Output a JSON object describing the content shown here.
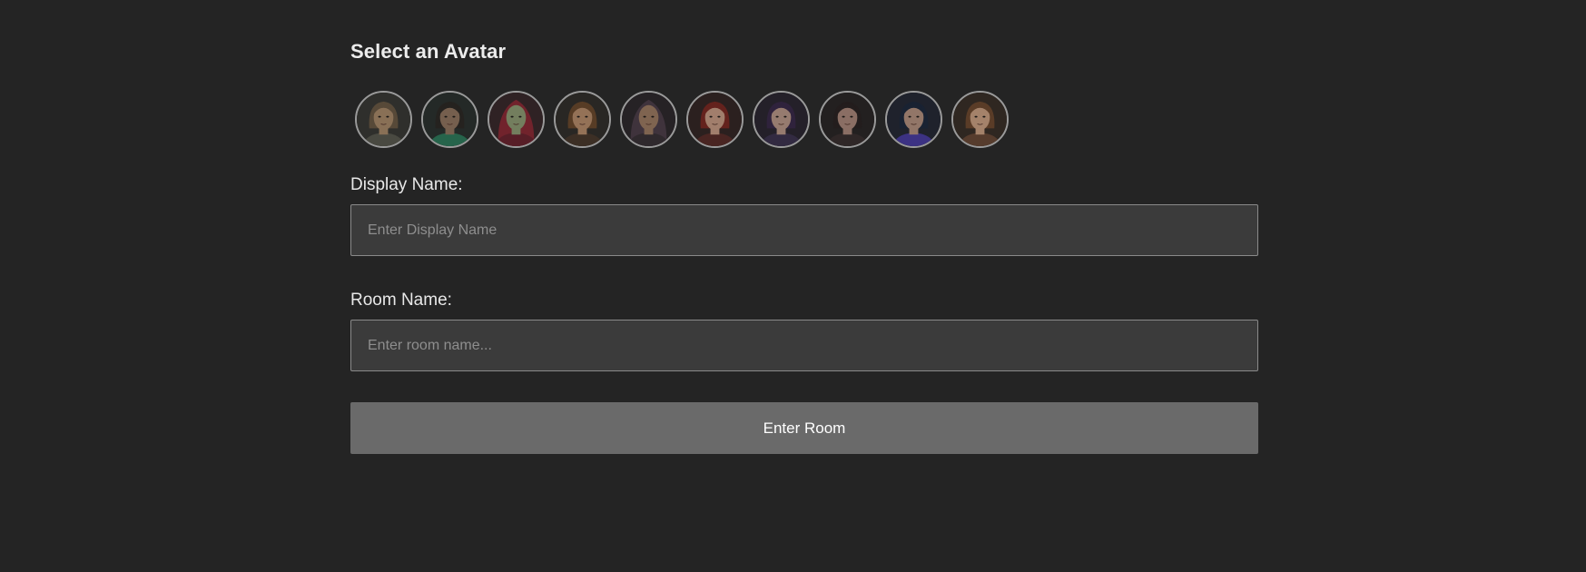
{
  "heading": "Select an Avatar",
  "avatars": [
    {
      "icon": "avatar-bald-man-icon",
      "skin": "#a8896a",
      "hair": "#6b5a45",
      "hood": null,
      "cloth": "#5a5a50",
      "bg": "#3a3a36"
    },
    {
      "icon": "avatar-bearded-man-icon",
      "skin": "#8f7560",
      "hair": "#2e2a26",
      "hood": null,
      "cloth": "#2f7a5c",
      "bg": "#2c3330"
    },
    {
      "icon": "avatar-red-hood-orc-icon",
      "skin": "#8d9a73",
      "hair": "#3a2a22",
      "hood": "#8a2b36",
      "cloth": "#6b2530",
      "bg": "#3a2a2c"
    },
    {
      "icon": "avatar-young-man-icon",
      "skin": "#b58b6b",
      "hair": "#6b4a2e",
      "hood": null,
      "cloth": "#4a3a2e",
      "bg": "#33302c"
    },
    {
      "icon": "avatar-hooded-warrior-icon",
      "skin": "#9c7a62",
      "hair": "#4a3c36",
      "hood": "#4e3f4a",
      "cloth": "#3a3238",
      "bg": "#2f2a2e"
    },
    {
      "icon": "avatar-red-hair-woman-icon",
      "skin": "#c59a84",
      "hair": "#7a2a24",
      "hood": null,
      "cloth": "#5a2e2a",
      "bg": "#352826"
    },
    {
      "icon": "avatar-purple-hair-woman-icon",
      "skin": "#b89688",
      "hair": "#3a2a4a",
      "hood": null,
      "cloth": "#3e3450",
      "bg": "#2c2833"
    },
    {
      "icon": "avatar-dark-hair-woman-icon",
      "skin": "#a9877a",
      "hair": "#2b2424",
      "hood": null,
      "cloth": "#3a3030",
      "bg": "#2b2828"
    },
    {
      "icon": "avatar-blue-hair-woman-icon",
      "skin": "#b3917f",
      "hair": "#1f2a3e",
      "hood": null,
      "cloth": "#4a3ea0",
      "bg": "#262a36"
    },
    {
      "icon": "avatar-brunette-woman-icon",
      "skin": "#c99f82",
      "hair": "#6e4a30",
      "hood": null,
      "cloth": "#6a4a38",
      "bg": "#3a3029"
    }
  ],
  "display_name": {
    "label": "Display Name:",
    "placeholder": "Enter Display Name",
    "value": ""
  },
  "room_name": {
    "label": "Room Name:",
    "placeholder": "Enter room name...",
    "value": ""
  },
  "enter_button": "Enter Room",
  "colors": {
    "background": "#242424",
    "input_background": "#3b3b3b",
    "input_border": "#8a8a8a",
    "button_background": "#6a6a6a",
    "avatar_ring": "#9a9a9a"
  }
}
